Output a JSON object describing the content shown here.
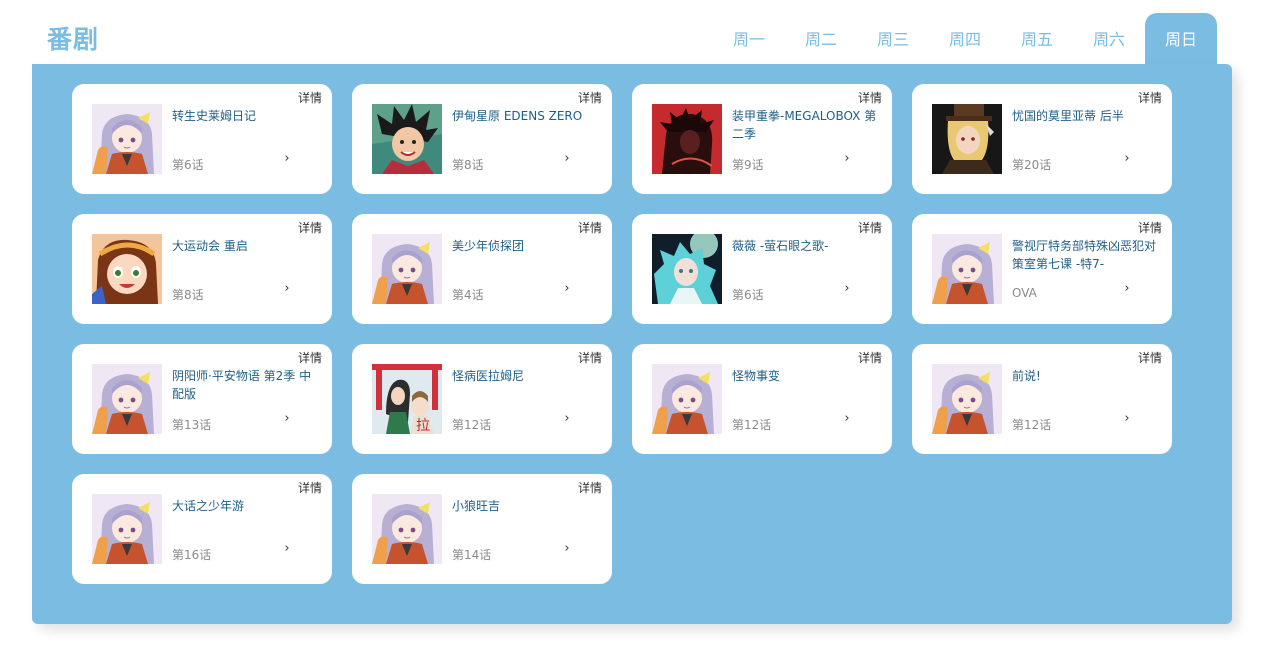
{
  "header": {
    "title": "番剧"
  },
  "tabs": [
    {
      "label": "周一"
    },
    {
      "label": "周二"
    },
    {
      "label": "周三"
    },
    {
      "label": "周四"
    },
    {
      "label": "周五"
    },
    {
      "label": "周六"
    },
    {
      "label": "周日",
      "active": true
    }
  ],
  "colors": {
    "accent": "#7bbde2",
    "title_text": "#1f5f86",
    "muted": "#8a8a8a"
  },
  "card_common": {
    "detail_label": "详情",
    "arrow_icon": "chevron-right-icon"
  },
  "cards": [
    {
      "title": "转生史莱姆日记",
      "episode": "第6话",
      "cover": "default-girl"
    },
    {
      "title": "伊甸星原 EDENS ZERO",
      "episode": "第8话",
      "cover": "edens-zero"
    },
    {
      "title": "装甲重拳-MEGALOBOX 第二季",
      "episode": "第9话",
      "cover": "megalobox"
    },
    {
      "title": "忧国的莫里亚蒂 后半",
      "episode": "第20话",
      "cover": "moriarty"
    },
    {
      "title": "大运动会 重启",
      "episode": "第8话",
      "cover": "undoukai"
    },
    {
      "title": "美少年侦探团",
      "episode": "第4话",
      "cover": "default-girl"
    },
    {
      "title": "薇薇 -萤石眼之歌-",
      "episode": "第6话",
      "cover": "vivy"
    },
    {
      "title": "警视厅特务部特殊凶恶犯对策室第七课 -特7-",
      "episode": "OVA",
      "cover": "default-girl"
    },
    {
      "title": "阴阳师·平安物语 第2季 中配版",
      "episode": "第13话",
      "cover": "default-girl"
    },
    {
      "title": "怪病医拉姆尼",
      "episode": "第12话",
      "cover": "ramune"
    },
    {
      "title": "怪物事变",
      "episode": "第12话",
      "cover": "default-girl"
    },
    {
      "title": "前说!",
      "episode": "第12话",
      "cover": "default-girl"
    },
    {
      "title": "大话之少年游",
      "episode": "第16话",
      "cover": "default-girl"
    },
    {
      "title": "小狼旺吉",
      "episode": "第14话",
      "cover": "default-girl"
    }
  ]
}
